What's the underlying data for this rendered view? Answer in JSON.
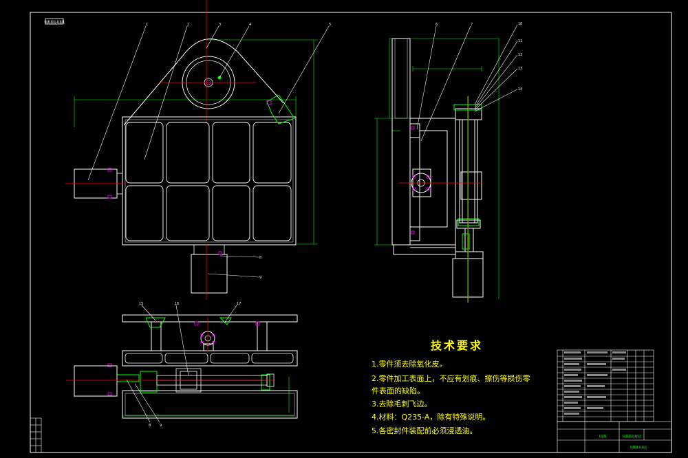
{
  "drawing": {
    "top_left_tag": "ЩЩЩ-ЩЩ"
  },
  "technical_requirements": {
    "title": "技术要求",
    "items": [
      "1.零件须去除氧化皮。",
      "2.零件加工表面上，不应有划痕、擦伤等损伤零",
      "件表面的缺陷。",
      "3.去除毛刺飞边。",
      "4.材料：Q235-A，除有特殊说明。",
      "5.各密封件装配前必须浸透油。"
    ]
  },
  "balloons": {
    "front": [
      "1",
      "2",
      "3",
      "4",
      "5"
    ],
    "side": [
      "6",
      "7",
      "10",
      "11",
      "12",
      "13",
      "14"
    ],
    "bottom": [
      "15",
      "16",
      "17",
      "8",
      "9"
    ],
    "below": [
      "8",
      "9"
    ]
  },
  "title_block": {
    "label_mid": "ЩЩ",
    "label_right": "ЩЩЩЩЩ",
    "label_bottom": "ЩЩ-ЩЩ"
  },
  "colors": {
    "outline": "#ffffff",
    "dimension": "#00ff00",
    "centerline": "#ff0000",
    "hidden": "#ff00ff",
    "text": "#ffff00",
    "frame": "#ffffff",
    "background": "#000000"
  }
}
